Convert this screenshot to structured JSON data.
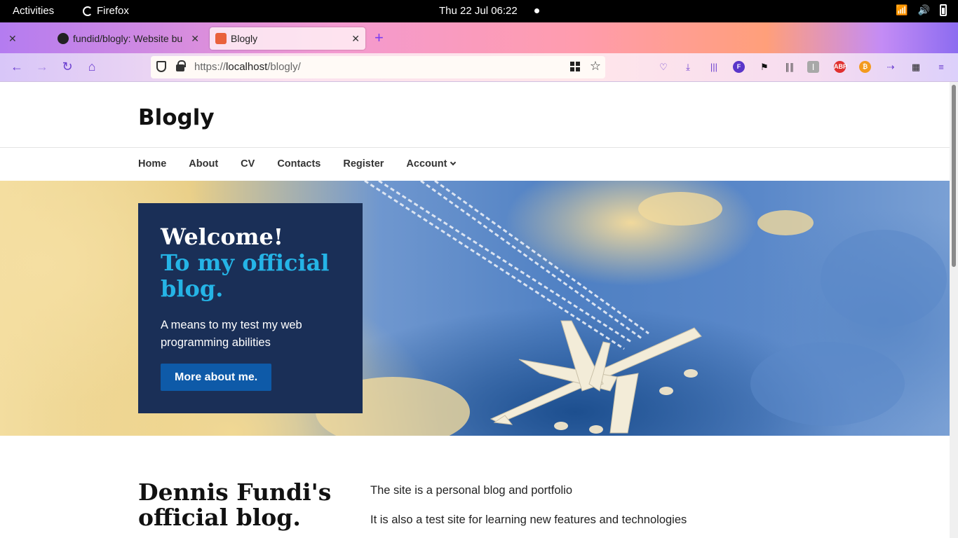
{
  "os": {
    "activities": "Activities",
    "app_name": "Firefox",
    "clock": "Thu 22 Jul  06:22"
  },
  "browser": {
    "tabs": [
      {
        "label": "fundid/blogly: Website bu",
        "active": false
      },
      {
        "label": "Blogly",
        "active": true
      }
    ],
    "url_scheme": "https://",
    "url_host": "localhost",
    "url_path": "/blogly/",
    "extensions": [
      "pocket-icon",
      "download-icon",
      "library-icon",
      "firefox-account-icon",
      "feedly-icon",
      "stacks-icon",
      "translate-icon",
      "adblock-plus-icon",
      "coin-icon",
      "forward-icon",
      "extensions-icon",
      "menu-icon"
    ],
    "colors": {
      "accent": "#7a3cf0"
    }
  },
  "site": {
    "title": "Blogly",
    "nav": [
      {
        "label": "Home"
      },
      {
        "label": "About"
      },
      {
        "label": "CV"
      },
      {
        "label": "Contacts"
      },
      {
        "label": "Register"
      },
      {
        "label": "Account"
      }
    ],
    "hero": {
      "heading": "Welcome!",
      "heading_accent": "To my official blog.",
      "lead": "A means to my test my web programming abilities",
      "button": "More about me.",
      "colors": {
        "card": "#1a2f57",
        "accent": "#25b4e6",
        "button": "#0e5aa8"
      }
    },
    "about": {
      "title": "Dennis Fundi's official blog.",
      "paragraphs": [
        "The site is a personal blog and portfolio",
        "It is also a test site for learning new features and technologies"
      ]
    }
  }
}
